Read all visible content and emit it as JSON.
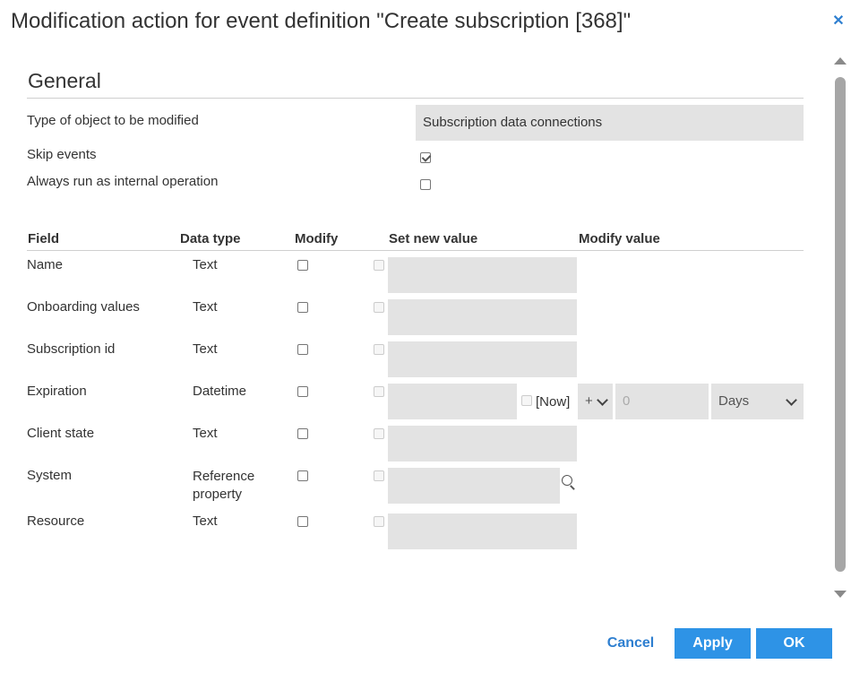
{
  "dialog": {
    "title": "Modification action for event definition \"Create subscription [368]\"",
    "close_icon": "close-icon",
    "accent_color": "#2e93e6"
  },
  "general": {
    "section_title": "General",
    "object_type_label": "Type of object to be modified",
    "object_type_value": "Subscription data connections",
    "skip_events_label": "Skip events",
    "skip_events_checked": true,
    "internal_op_label": "Always run as internal operation",
    "internal_op_checked": false
  },
  "table": {
    "headers": {
      "field": "Field",
      "data_type": "Data type",
      "modify": "Modify",
      "set_new_value": "Set new value",
      "modify_value": "Modify value"
    },
    "rows": [
      {
        "field": "Name",
        "type": "Text",
        "modify": false
      },
      {
        "field": "Onboarding values",
        "type": "Text",
        "modify": false
      },
      {
        "field": "Subscription id",
        "type": "Text",
        "modify": false
      },
      {
        "field": "Expiration",
        "type": "Datetime",
        "modify": false
      },
      {
        "field": "Client state",
        "type": "Text",
        "modify": false
      },
      {
        "field": "System",
        "type": "Reference property",
        "modify": false
      },
      {
        "field": "Resource",
        "type": "Text",
        "modify": false
      }
    ],
    "expiration": {
      "now_label": "[Now]",
      "operator": "+",
      "amount_placeholder": "0",
      "unit": "Days"
    }
  },
  "footer": {
    "cancel_label": "Cancel",
    "apply_label": "Apply",
    "ok_label": "OK"
  }
}
